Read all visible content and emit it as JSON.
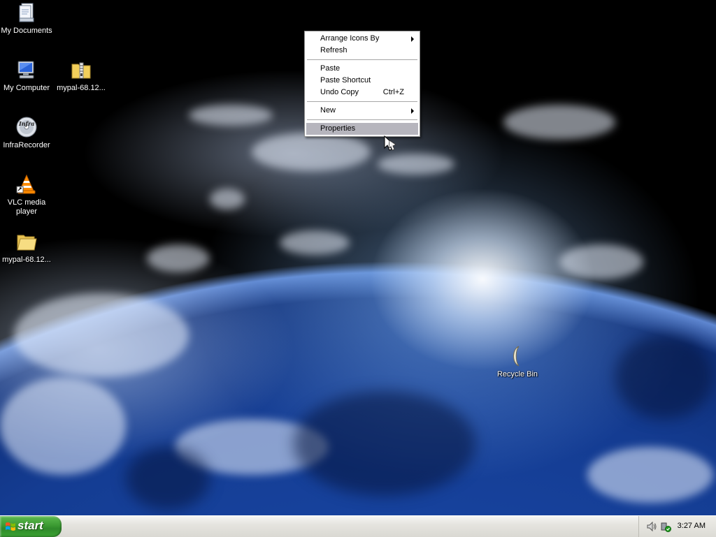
{
  "desktop": {
    "icons": [
      {
        "label": "My Documents",
        "icon": "my-documents-icon"
      },
      {
        "label": "My Computer",
        "icon": "my-computer-icon"
      },
      {
        "label": "mypal-68.12...",
        "icon": "zip-folder-icon"
      },
      {
        "label": "InfraRecorder",
        "icon": "infrarecorder-icon"
      },
      {
        "label": "VLC media\nplayer",
        "icon": "vlc-icon"
      },
      {
        "label": "mypal-68.12...",
        "icon": "folder-icon"
      },
      {
        "label": "Recycle Bin",
        "icon": "recycle-bin-icon"
      }
    ]
  },
  "context_menu": {
    "items": [
      {
        "label": "Arrange Icons By",
        "submenu": true
      },
      {
        "label": "Refresh"
      },
      {
        "label": "Paste"
      },
      {
        "label": "Paste Shortcut"
      },
      {
        "label": "Undo Copy",
        "shortcut": "Ctrl+Z"
      },
      {
        "label": "New",
        "submenu": true
      },
      {
        "label": "Properties",
        "highlighted": true
      }
    ]
  },
  "taskbar": {
    "start_label": "start",
    "clock": "3:27 AM",
    "tray_icons": [
      "speaker-icon",
      "safely-remove-hardware-icon"
    ]
  },
  "colors": {
    "start_green": "#3b9a32",
    "menu_highlight": "#b6b5bd",
    "taskbar": "#e5e4df"
  }
}
